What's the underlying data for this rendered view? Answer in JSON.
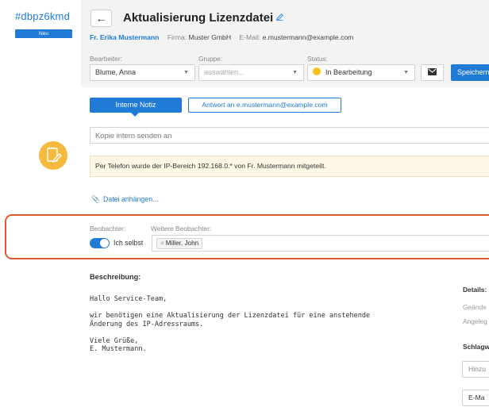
{
  "ticket": {
    "id": "#dbpz6kmd",
    "badge": "Neu"
  },
  "header": {
    "back_icon": "arrow-left-icon",
    "title": "Aktualisierung Lizenzdatei",
    "edit_icon": "pencil-icon",
    "customer_name": "Fr. Erika Mustermann",
    "company_label": "Firma:",
    "company": "Muster GmbH",
    "email_label": "E-Mail:",
    "email": "e.mustermann@example.com"
  },
  "fields": {
    "assignee_label": "Bearbeiter:",
    "assignee_value": "Blume, Anna",
    "group_label": "Gruppe:",
    "group_placeholder": "auswählen...",
    "status_label": "Status:",
    "status_value": "In Bearbeitung",
    "status_color": "#f5c21b"
  },
  "actions": {
    "mail_icon": "envelope-icon",
    "save_label": "Speichern"
  },
  "compose": {
    "tab_internal": "Interne Notiz",
    "tab_reply": "Antwort an e.mustermann@example.com",
    "copy_placeholder": "Kopie intern senden an",
    "note_icon": "note-pencil-icon",
    "note_text": "Per Telefon wurde der IP-Bereich 192.168.0.* von Fr. Mustermann mitgeteilt.",
    "attach_icon": "paperclip-icon",
    "attach_label": "Datei anhängen..."
  },
  "watchers": {
    "label": "Beobachter:",
    "more_label": "Weitere Beobachter:",
    "self_label": "Ich selbst",
    "self_enabled": true,
    "chips": [
      "Miller, John"
    ]
  },
  "description": {
    "label": "Beschreibung:",
    "text": "Hallo Service-Team,\n\nwir benötigen eine Aktualisierung der Lizenzdatei für eine anstehende\nÄnderung des IP-Adressraums.\n\nViele Grüße,\nE. Mustermann."
  },
  "side": {
    "details_label": "Details:",
    "changed_label": "Geände",
    "created_label": "Angeleg",
    "tags_label": "Schlagw",
    "add_placeholder": "Hinzu",
    "email_button": "E-Ma"
  },
  "colors": {
    "accent": "#1f7bd6",
    "highlight": "#e05a2f",
    "note_bg": "#fdf8e5",
    "status": "#f5c21b"
  }
}
